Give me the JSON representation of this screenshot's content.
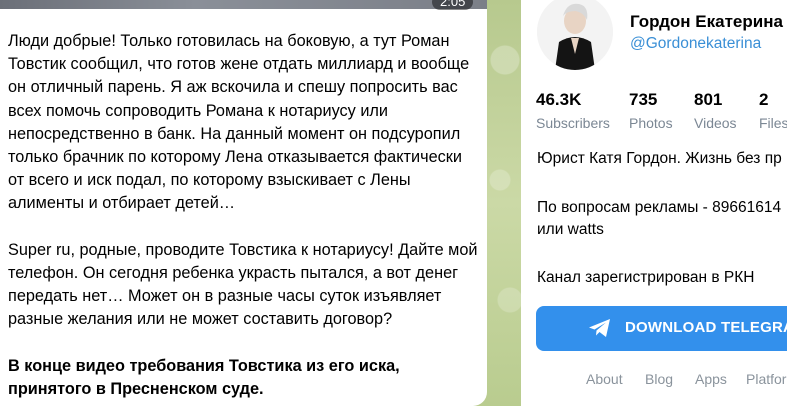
{
  "video": {
    "duration": "2:05"
  },
  "message": {
    "paragraphs": [
      "Люди добрые! Только готовилась на боковую, а тут Роман Товстик сообщил, что готов жене отдать миллиард и вообще он отличный парень. Я аж вскочила и спешу попросить вас всех помочь сопроводить Романа к нотариусу или непосредственно в банк. На данный момент он подсуропил только брачник по которому Лена отказывается фактически от всего и иск подал, по которому взыскивает с Лены алименты и отбирает детей…",
      "Super ru, родные, проводите Товстика к нотариусу! Дайте мой телефон. Он сегодня ребенка украсть пытался, а вот денег передать нет… Может он в разные часы суток изъявляет разные желания или не может составить договор?",
      "В конце видео требования Товстика из его иска, принятого в Пресненском суде."
    ]
  },
  "channel": {
    "name": "Гордон Екатерина",
    "handle": "@Gordonekaterina",
    "stats": [
      {
        "value": "46.3K",
        "label": "Subscribers"
      },
      {
        "value": "735",
        "label": "Photos"
      },
      {
        "value": "801",
        "label": "Videos"
      },
      {
        "value": "2",
        "label": "Files"
      }
    ],
    "description": [
      "Юрист Катя Гордон. Жизнь без пр",
      "По вопросам рекламы - 89661614",
      "или watts",
      "Канал зарегистрирован в РКН"
    ],
    "download_label": "DOWNLOAD TELEGRAM",
    "footer_links": [
      "About",
      "Blog",
      "Apps",
      "Platforms"
    ]
  },
  "colors": {
    "accent": "#3390ec",
    "link": "#3a8fd6",
    "chat_background": "#c9d7a8"
  }
}
